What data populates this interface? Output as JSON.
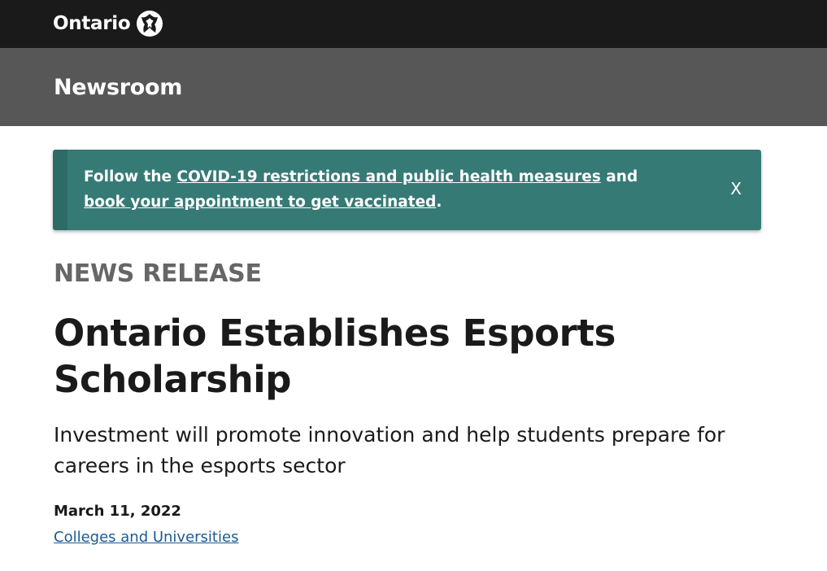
{
  "header": {
    "logo_text": "Ontario",
    "logo_icon": "ontario-trillium-icon"
  },
  "section": {
    "title": "Newsroom"
  },
  "alert": {
    "prefix": "Follow the ",
    "link1": "COVID-19 restrictions and public health measures",
    "middle": " and",
    "link2": "book your appointment to get vaccinated",
    "suffix": ".",
    "close_label": "X",
    "background_color": "#367a76"
  },
  "article": {
    "label": "NEWS RELEASE",
    "headline": "Ontario Establishes Esports Scholarship",
    "subheadline": "Investment will promote innovation and help students prepare for careers in the esports sector",
    "date": "March 11, 2022",
    "ministry_link": "Colleges and Universities"
  }
}
